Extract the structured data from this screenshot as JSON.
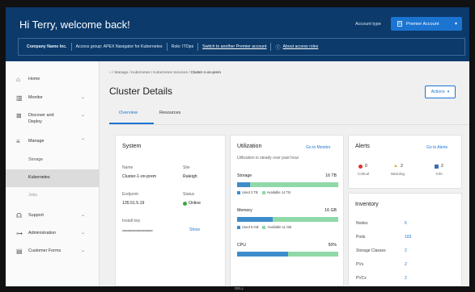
{
  "header": {
    "welcome": "Hi Terry, welcome back!",
    "account_type_label": "Account type",
    "account_type_value": "Premier Account",
    "company": "Company Name Inc.",
    "access_group": "Access group: APEX Navigator for Kubernetes",
    "role": "Role: ITOps",
    "switch_link": "Switch to another Premier account",
    "roles_link": "About access roles"
  },
  "sidebar": {
    "items": [
      {
        "label": "Home",
        "icon": "home-icon"
      },
      {
        "label": "Monitor",
        "icon": "monitor-icon"
      },
      {
        "label": "Discover and Deploy",
        "icon": "discover-icon"
      },
      {
        "label": "Manage",
        "icon": "manage-icon"
      },
      {
        "label": "Support",
        "icon": "support-icon"
      },
      {
        "label": "Administration",
        "icon": "admin-icon"
      },
      {
        "label": "Customer Forms",
        "icon": "forms-icon"
      }
    ],
    "sub_items": [
      "Storage",
      "Kubernetes",
      "Jobs"
    ]
  },
  "breadcrumb": {
    "items": [
      "Manage",
      "Kubernetes",
      "Kubernetes Services",
      "Cluster-1-on-prem"
    ]
  },
  "page": {
    "title": "Cluster Details",
    "actions_label": "Actions",
    "tabs": [
      "Overview",
      "Resources"
    ]
  },
  "system": {
    "title": "System",
    "name_label": "Name",
    "name_value": "Cluster-1-on-prem",
    "site_label": "Site",
    "site_value": "Raleigh",
    "endpoint_label": "Endpoint",
    "endpoint_value": "135.51.5.19",
    "status_label": "Status",
    "status_value": "Online",
    "install_key_label": "Install key",
    "install_key_value": "••••••••••••••••••••••••••••••••••",
    "show_label": "Show"
  },
  "utilization": {
    "title": "Utilization",
    "go_link": "Go to Monitor",
    "subtitle": "Utilization is steady over past hour",
    "storage_label": "Storage",
    "storage_total": "16 TB",
    "storage_used_fraction": 0.125,
    "storage_used_legend": "Used 2 TB",
    "storage_avail_legend": "Available 14 TB",
    "memory_label": "Memory",
    "memory_total": "16 GB",
    "memory_used_fraction": 0.35,
    "memory_used_legend": "Used 5 GB",
    "memory_avail_legend": "Available 11 GB",
    "cpu_label": "CPU",
    "cpu_total": "50%",
    "cpu_used_fraction": 0.5
  },
  "alerts": {
    "title": "Alerts",
    "go_link": "Go to Alerts",
    "critical_count": "0",
    "critical_label": "Critical",
    "warning_count": "2",
    "warning_label": "Warning",
    "info_count": "2",
    "info_label": "Info"
  },
  "inventory": {
    "title": "Inventory",
    "rows": [
      {
        "label": "Nodes",
        "value": "6"
      },
      {
        "label": "Pods",
        "value": "103"
      },
      {
        "label": "Storage Classes",
        "value": "2"
      },
      {
        "label": "PVs",
        "value": "2"
      },
      {
        "label": "PVCs",
        "value": "2"
      }
    ]
  },
  "footer": {
    "brand": "DELL"
  },
  "colors": {
    "header_bg": "#0b3a6b",
    "accent": "#1c74d1",
    "used": "#3d8ccc",
    "available": "#8fd9a8",
    "critical": "#d9342b",
    "warning": "#f4a81d",
    "info": "#3d6fb6",
    "online": "#3da63d"
  }
}
